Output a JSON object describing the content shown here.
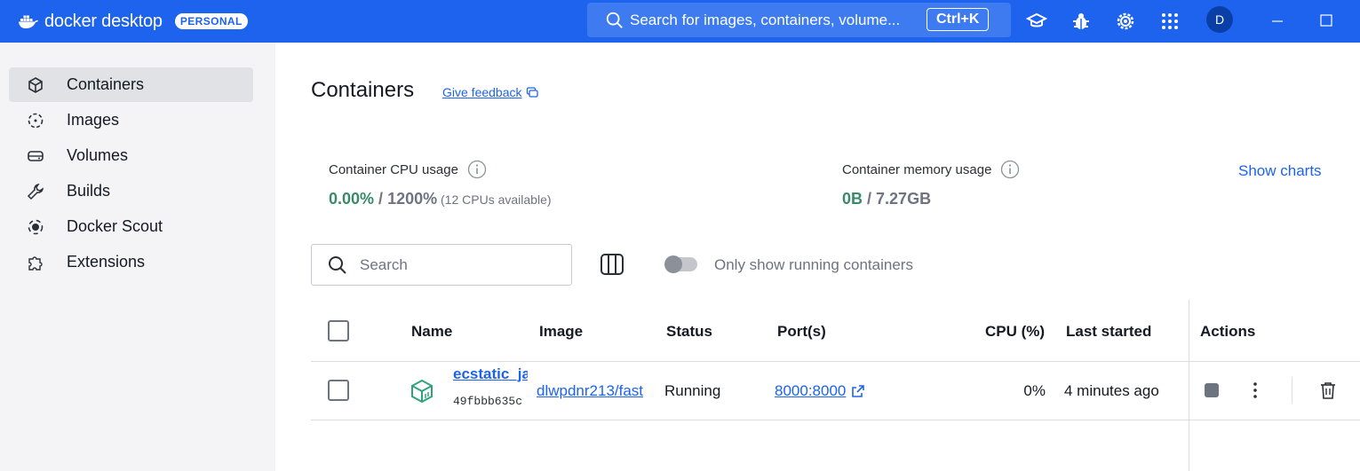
{
  "app": {
    "brand_name": "docker desktop",
    "plan_badge": "PERSONAL",
    "search_placeholder": "Search for images, containers, volume...",
    "search_shortcut": "Ctrl+K",
    "avatar_initial": "D",
    "accent_color": "#1d63ed",
    "icons": [
      "learning-center-icon",
      "troubleshoot-icon",
      "settings-icon",
      "extensions-grid-icon",
      "minimize-icon",
      "maximize-icon"
    ]
  },
  "sidebar": {
    "items": [
      {
        "label": "Containers",
        "icon": "container-icon",
        "active": true
      },
      {
        "label": "Images",
        "icon": "image-icon",
        "active": false
      },
      {
        "label": "Volumes",
        "icon": "volume-icon",
        "active": false
      },
      {
        "label": "Builds",
        "icon": "wrench-icon",
        "active": false
      },
      {
        "label": "Docker Scout",
        "icon": "scout-icon",
        "active": false
      },
      {
        "label": "Extensions",
        "icon": "puzzle-icon",
        "active": false
      }
    ]
  },
  "main": {
    "title": "Containers",
    "feedback_label": "Give feedback",
    "cpu": {
      "label": "Container CPU usage",
      "used": "0.00%",
      "separator": " / ",
      "total": "1200%",
      "note": " (12 CPUs available)"
    },
    "memory": {
      "label": "Container memory usage",
      "used": "0B",
      "separator": " / ",
      "total": "7.27GB"
    },
    "show_charts_label": "Show charts",
    "search_placeholder": "Search",
    "running_toggle_label": "Only show running containers",
    "running_toggle_on": false
  },
  "table": {
    "headers": {
      "name": "Name",
      "image": "Image",
      "status": "Status",
      "ports": "Port(s)",
      "cpu": "CPU (%)",
      "last_started": "Last started",
      "actions": "Actions"
    },
    "rows": [
      {
        "name": "ecstatic_ja",
        "id": "49fbbb635c",
        "image": "dlwpdnr213/fast",
        "status": "Running",
        "ports": "8000:8000",
        "cpu": "0%",
        "last_started": "4 minutes ago"
      }
    ]
  }
}
